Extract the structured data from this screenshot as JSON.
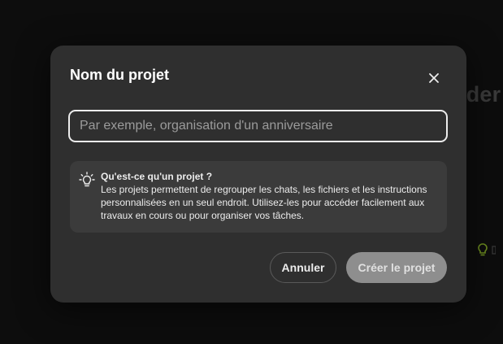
{
  "background": {
    "heading_fragment": "ider"
  },
  "dialog": {
    "title": "Nom du projet",
    "close_icon": "close-icon",
    "input": {
      "value": "",
      "placeholder": "Par exemple, organisation d'un anniversaire"
    },
    "info": {
      "icon": "lightbulb-icon",
      "title": "Qu'est-ce qu'un projet ?",
      "text": "Les projets permettent de regrouper les chats, les fichiers et les instructions personnalisées en un seul endroit. Utilisez-les pour accéder facilement aux travaux en cours ou pour organiser vos tâches."
    },
    "buttons": {
      "cancel_label": "Annuler",
      "create_label": "Créer le projet"
    }
  },
  "colors": {
    "dialog_bg": "#2f2f2f",
    "info_bg": "#3b3b3b",
    "input_border": "#ececec",
    "create_button_bg": "#8e8e8e",
    "text": "#ececec"
  }
}
